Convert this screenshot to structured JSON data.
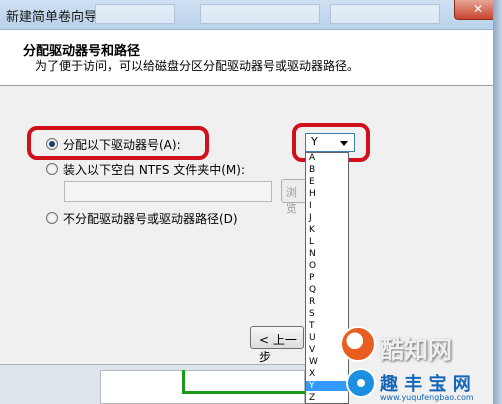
{
  "window": {
    "title": "新建简单卷向导",
    "close_glyph": "✕"
  },
  "header": {
    "heading": "分配驱动器号和路径",
    "subheading": "为了便于访问，可以给磁盘分区分配驱动器号或驱动器路径。"
  },
  "options": {
    "assign_letter": {
      "label": "分配以下驱动器号(A):",
      "checked": true
    },
    "mount_folder": {
      "label": "装入以下空白 NTFS 文件夹中(M):",
      "checked": false
    },
    "none": {
      "label": "不分配驱动器号或驱动器路径(D)",
      "checked": false
    }
  },
  "drive_combo": {
    "selected": "Y"
  },
  "drive_list": {
    "items": [
      "A",
      "B",
      "E",
      "H",
      "I",
      "J",
      "K",
      "L",
      "N",
      "O",
      "P",
      "Q",
      "R",
      "S",
      "T",
      "U",
      "V",
      "W",
      "X",
      "Y",
      "Z"
    ],
    "selected": "Y"
  },
  "folder_path": {
    "value": ""
  },
  "browse_button": {
    "label": "浏览"
  },
  "nav": {
    "back_label": "< 上一步"
  },
  "watermark": {
    "brand1": "酷知网",
    "brand2": "趣 丰 宝 网",
    "url": "www.yuqufengbao.com"
  },
  "colors": {
    "highlight_ring": "#d0101a",
    "selection": "#3399ff"
  }
}
